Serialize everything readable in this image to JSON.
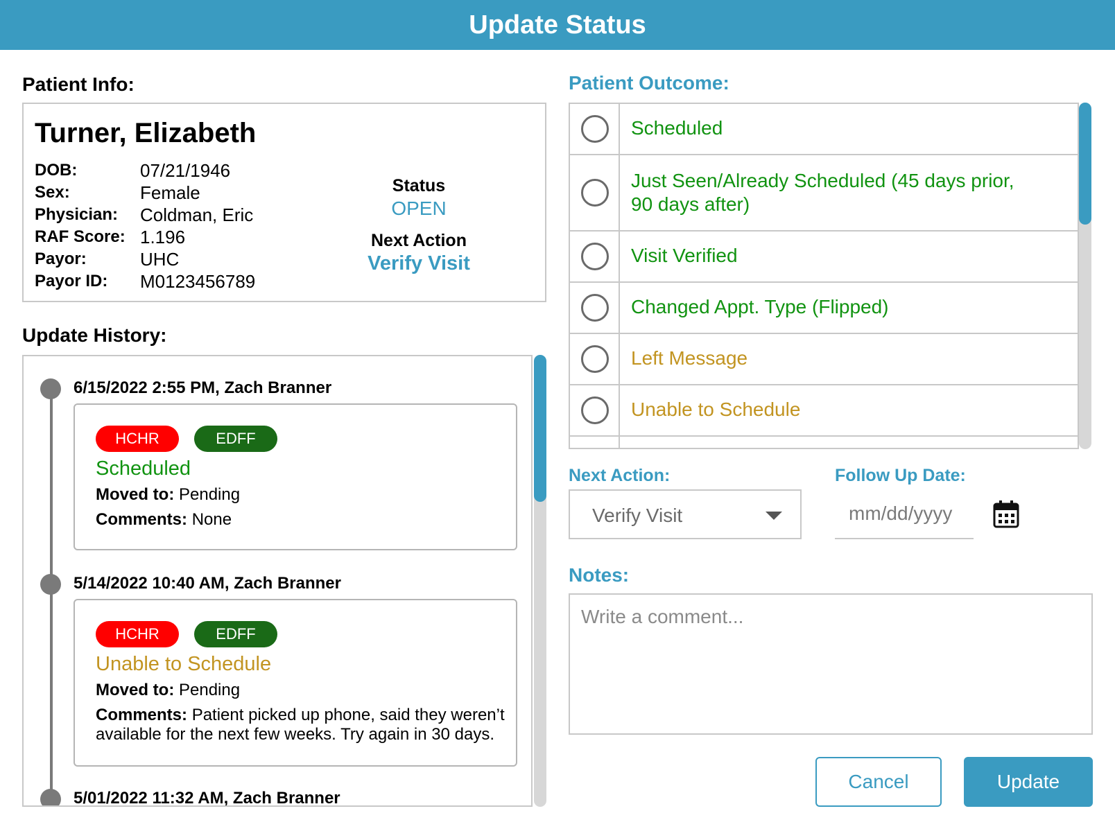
{
  "header": {
    "title": "Update Status"
  },
  "patient_info": {
    "label": "Patient Info:",
    "name": "Turner, Elizabeth",
    "fields": [
      {
        "key": "DOB:",
        "value": "07/21/1946"
      },
      {
        "key": "Sex:",
        "value": "Female"
      },
      {
        "key": "Physician:",
        "value": "Coldman, Eric"
      },
      {
        "key": "RAF Score:",
        "value": "1.196"
      },
      {
        "key": "Payor:",
        "value": "UHC"
      },
      {
        "key": "Payor ID:",
        "value": "M0123456789"
      }
    ],
    "status_label": "Status",
    "status_value": "OPEN",
    "next_action_label": "Next Action",
    "next_action_value": "Verify Visit"
  },
  "history": {
    "label": "Update History:",
    "entries": [
      {
        "header": "6/15/2022 2:55 PM, Zach Branner",
        "badges": [
          "HCHR",
          "EDFF"
        ],
        "outcome": "Scheduled",
        "moved_label": "Moved to:",
        "moved_value": "Pending",
        "comments_label": "Comments:",
        "comments_value": "None"
      },
      {
        "header": "5/14/2022 10:40 AM, Zach Branner",
        "badges": [
          "HCHR",
          "EDFF"
        ],
        "outcome": "Unable to Schedule",
        "moved_label": "Moved to:",
        "moved_value": "Pending",
        "comments_label": "Comments:",
        "comments_value": "Patient picked up phone, said they weren’t",
        "comments_value_2": "available for the next few weeks. Try again in 30 days."
      },
      {
        "header": "5/01/2022 11:32 AM, Zach Branner"
      }
    ]
  },
  "outcome": {
    "label": "Patient Outcome:",
    "options": [
      {
        "label": "Scheduled"
      },
      {
        "label": "Just Seen/Already Scheduled (45 days prior,",
        "label_2": "90 days after)"
      },
      {
        "label": "Visit Verified"
      },
      {
        "label": "Changed Appt. Type (Flipped)"
      },
      {
        "label": "Left Message"
      },
      {
        "label": "Unable to Schedule"
      }
    ]
  },
  "form": {
    "next_action_label": "Next Action:",
    "next_action_value": "Verify Visit",
    "follow_up_label": "Follow Up Date:",
    "follow_up_placeholder": "mm/dd/yyyy",
    "notes_label": "Notes:",
    "notes_placeholder": "Write a comment..."
  },
  "buttons": {
    "cancel": "Cancel",
    "update": "Update"
  },
  "colors": {
    "accent": "#3a9bc1",
    "green_outcome": "#119311",
    "gold_outcome": "#c29421",
    "badge_red": "#ff0000",
    "badge_green": "#1a6a17"
  },
  "icons": [
    "calendar-icon",
    "chevron-down-icon",
    "radio-icon",
    "timeline-dot-icon"
  ]
}
